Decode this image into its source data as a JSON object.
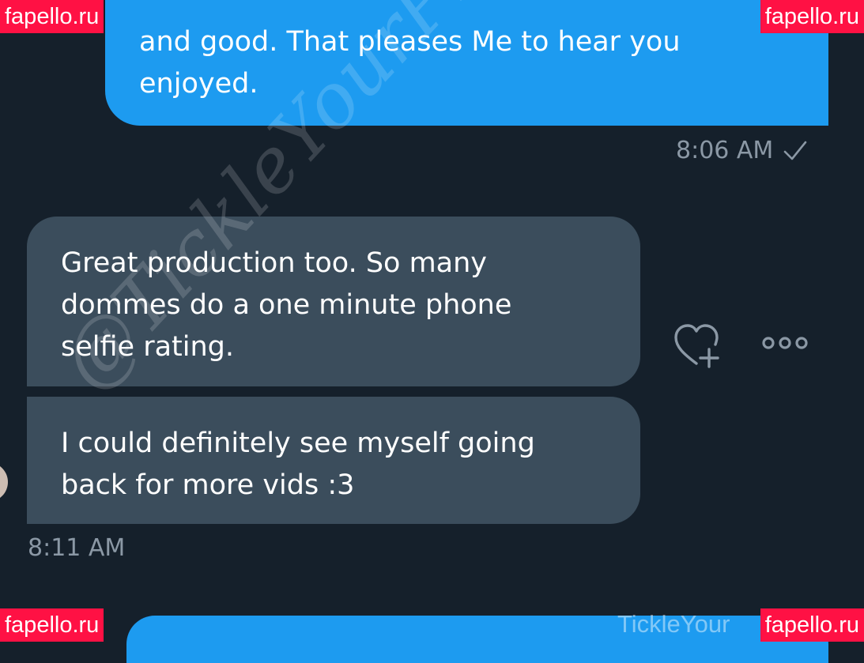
{
  "messages": [
    {
      "direction": "outgoing",
      "text": "and good. That pleases Me to hear you\nenjoyed."
    },
    {
      "direction": "incoming",
      "text": "Great production too. So many\ndommes do a one minute phone\nselfie rating."
    },
    {
      "direction": "incoming",
      "text": "I could definitely see myself going\nback for more vids :3"
    }
  ],
  "timestamps": {
    "outgoing": "8:06 AM",
    "incoming": "8:11 AM"
  },
  "icons": {
    "read_receipt": "check-icon",
    "react": "heart-plus-icon",
    "more": "more-options-icon"
  },
  "watermarks": {
    "diagonal": "@TickleYourPhalanges",
    "site_badge": "fapello.ru",
    "footer": "TickleYour"
  },
  "colors": {
    "background": "#15202b",
    "outgoing_bubble": "#1d9bf0",
    "incoming_bubble": "#3b4d5c",
    "timestamp": "#8b98a5",
    "badge": "#ff1144"
  }
}
